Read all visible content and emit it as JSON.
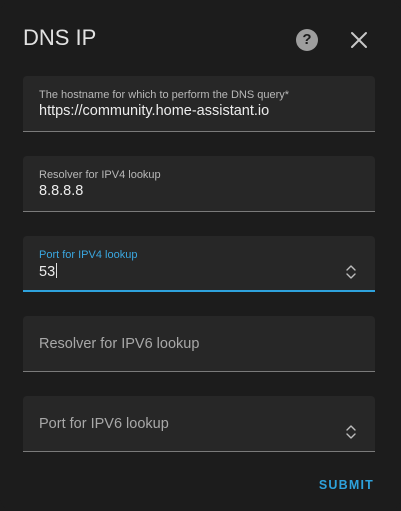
{
  "dialog": {
    "title": "DNS IP",
    "help_icon": "help-circle-icon",
    "close_icon": "close-icon"
  },
  "fields": {
    "hostname": {
      "label": "The hostname for which to perform the DNS query*",
      "value": "https://community.home-assistant.io"
    },
    "resolver_ipv4": {
      "label": "Resolver for IPV4 lookup",
      "value": "8.8.8.8"
    },
    "port_ipv4": {
      "label": "Port for IPV4 lookup",
      "value": "53"
    },
    "resolver_ipv6": {
      "label": "Resolver for IPV6 lookup",
      "value": ""
    },
    "port_ipv6": {
      "label": "Port for IPV6 lookup",
      "value": ""
    }
  },
  "actions": {
    "submit_label": "SUBMIT"
  },
  "colors": {
    "background": "#1c1c1c",
    "field_background": "#272727",
    "accent": "#2ea2dc",
    "text": "#e1e1e1"
  }
}
